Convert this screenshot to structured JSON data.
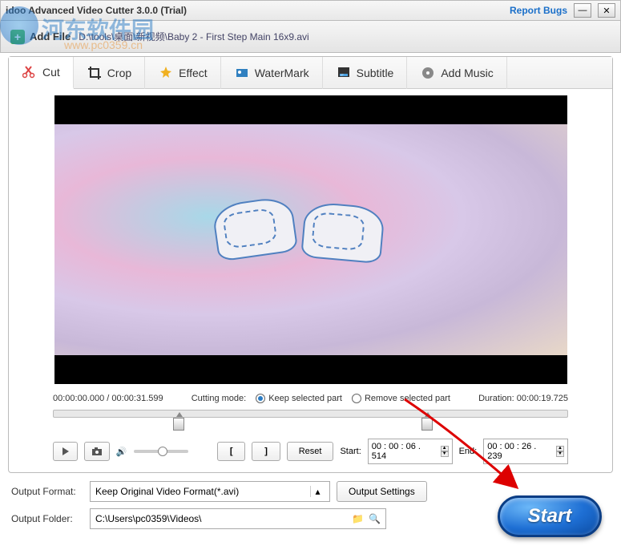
{
  "window": {
    "title": "idoo Advanced Video Cutter 3.0.0 (Trial)",
    "report_bugs": "Report Bugs"
  },
  "watermark": {
    "text": "河东软件园",
    "sub": "www.pc0359.cn"
  },
  "toolbar": {
    "add_file": "Add File",
    "file_path": "D:\\tools\\桌面\\新视频\\Baby 2 - First Step Main 16x9.avi"
  },
  "tabs": {
    "cut": "Cut",
    "crop": "Crop",
    "effect": "Effect",
    "watermark": "WaterMark",
    "subtitle": "Subtitle",
    "addmusic": "Add Music"
  },
  "info": {
    "time_pos": "00:00:00.000 / 00:00:31.599",
    "cutting_mode_label": "Cutting mode:",
    "keep_label": "Keep selected part",
    "remove_label": "Remove selected part",
    "duration_label": "Duration:",
    "duration_value": "00:00:19.725"
  },
  "controls": {
    "reset": "Reset",
    "start_label": "Start:",
    "start_value": "00 : 00 : 06 . 514",
    "end_label": "End:",
    "end_value": "00 : 00 : 26 . 239"
  },
  "output": {
    "format_label": "Output Format:",
    "format_value": "Keep Original Video Format(*.avi)",
    "settings_btn": "Output Settings",
    "folder_label": "Output Folder:",
    "folder_value": "C:\\Users\\pc0359\\Videos\\"
  },
  "start_button": "Start"
}
